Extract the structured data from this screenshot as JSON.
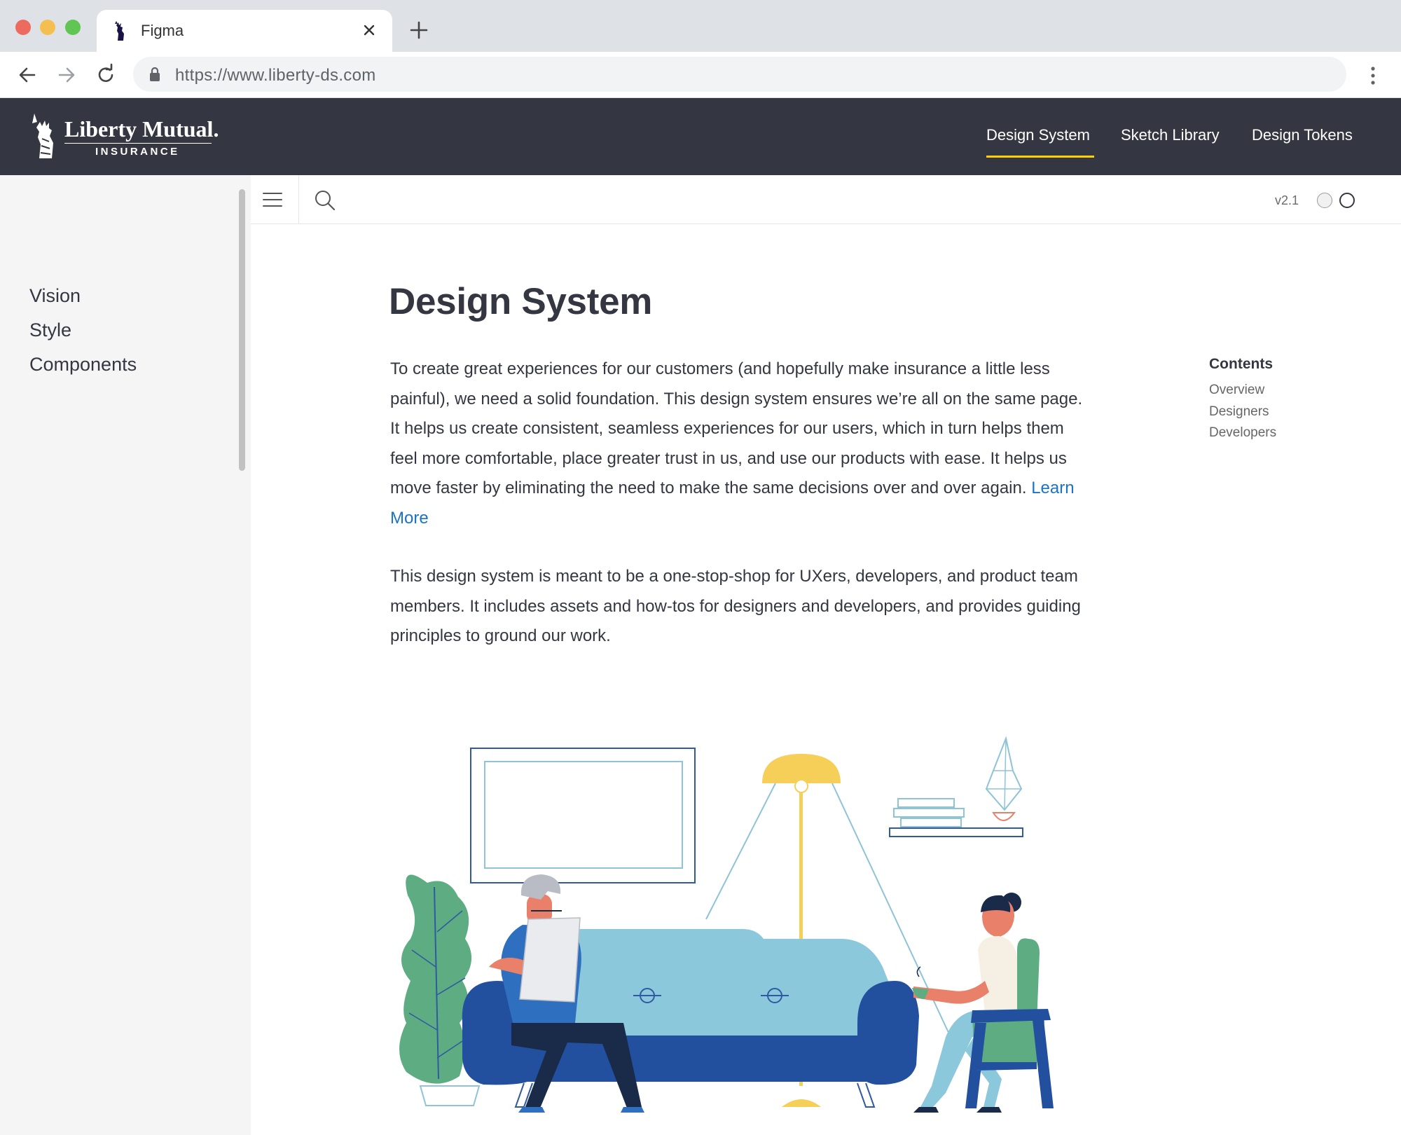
{
  "browser": {
    "tab_title": "Figma",
    "url": "https://www.liberty-ds.com"
  },
  "header": {
    "logo_name": "Liberty Mutual.",
    "logo_sub": "INSURANCE",
    "nav": [
      {
        "label": "Design System",
        "active": true
      },
      {
        "label": "Sketch Library",
        "active": false
      },
      {
        "label": "Design Tokens",
        "active": false
      }
    ],
    "accent_color": "#ffd000"
  },
  "sidebar": {
    "items": [
      {
        "label": "Vision"
      },
      {
        "label": "Style"
      },
      {
        "label": "Components"
      }
    ]
  },
  "utility": {
    "version": "v2.1"
  },
  "main": {
    "title": "Design System",
    "paragraph1": "To create great experiences for our customers (and hopefully make insurance a little less painful), we need a solid foundation. This design system ensures we’re all on the same page. It helps us create consistent, seamless experiences for our users, which in turn helps them feel more comfortable, place greater trust in us, and use our products with ease. It helps us move faster by eliminating the need to make the same decisions over and over again.",
    "learn_more": "Learn More",
    "paragraph2": "This design system is meant to be a one-stop-shop for UXers, developers, and product team members. It includes assets and how-tos for designers and developers, and provides guiding principles to ground our work."
  },
  "contents": {
    "heading": "Contents",
    "items": [
      {
        "label": "Overview"
      },
      {
        "label": "Designers"
      },
      {
        "label": "Developers"
      }
    ]
  }
}
